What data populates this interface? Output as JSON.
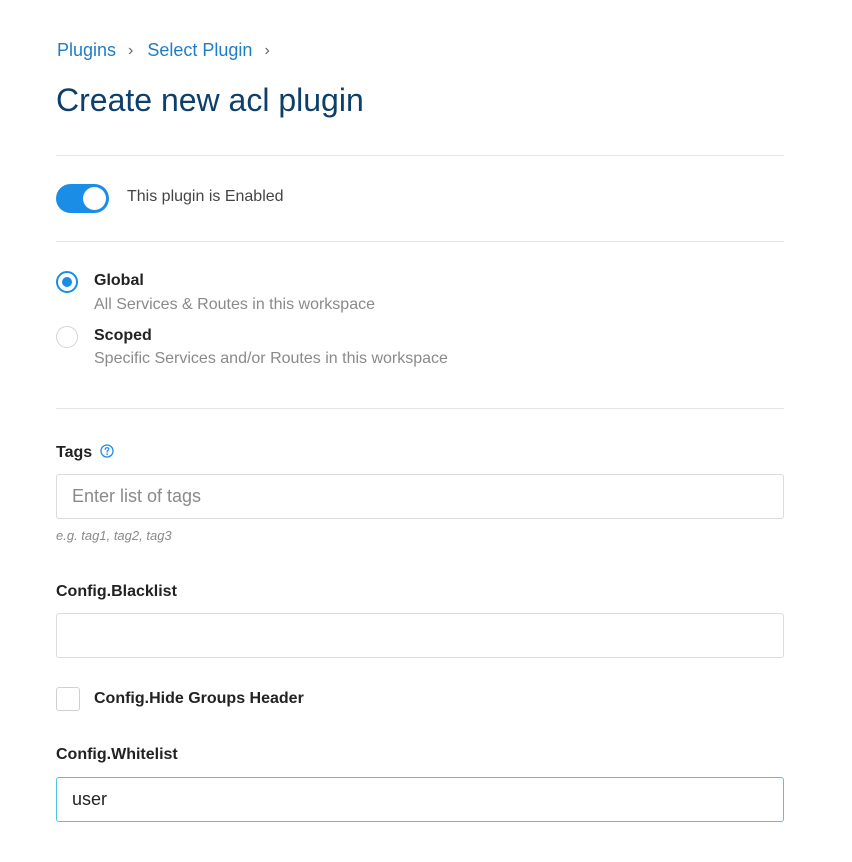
{
  "breadcrumb": {
    "items": [
      "Plugins",
      "Select Plugin"
    ],
    "separator": "›"
  },
  "page": {
    "title": "Create new acl plugin"
  },
  "enabled_toggle": {
    "label": "This plugin is Enabled",
    "on": true
  },
  "scope": {
    "options": [
      {
        "label": "Global",
        "description": "All Services & Routes in this workspace",
        "selected": true
      },
      {
        "label": "Scoped",
        "description": "Specific Services and/or Routes in this workspace",
        "selected": false
      }
    ]
  },
  "tags": {
    "label": "Tags",
    "placeholder": "Enter list of tags",
    "value": "",
    "hint": "e.g. tag1, tag2, tag3",
    "help_icon": "question-circle-icon"
  },
  "blacklist": {
    "label": "Config.Blacklist",
    "value": ""
  },
  "hide_groups_header": {
    "label": "Config.Hide Groups Header",
    "checked": false
  },
  "whitelist": {
    "label": "Config.Whitelist",
    "value": "user"
  },
  "colors": {
    "accent": "#1a8ee6",
    "title": "#0d3f6b",
    "link": "#1f7cc6",
    "focus_border": "#4cc6e2"
  }
}
